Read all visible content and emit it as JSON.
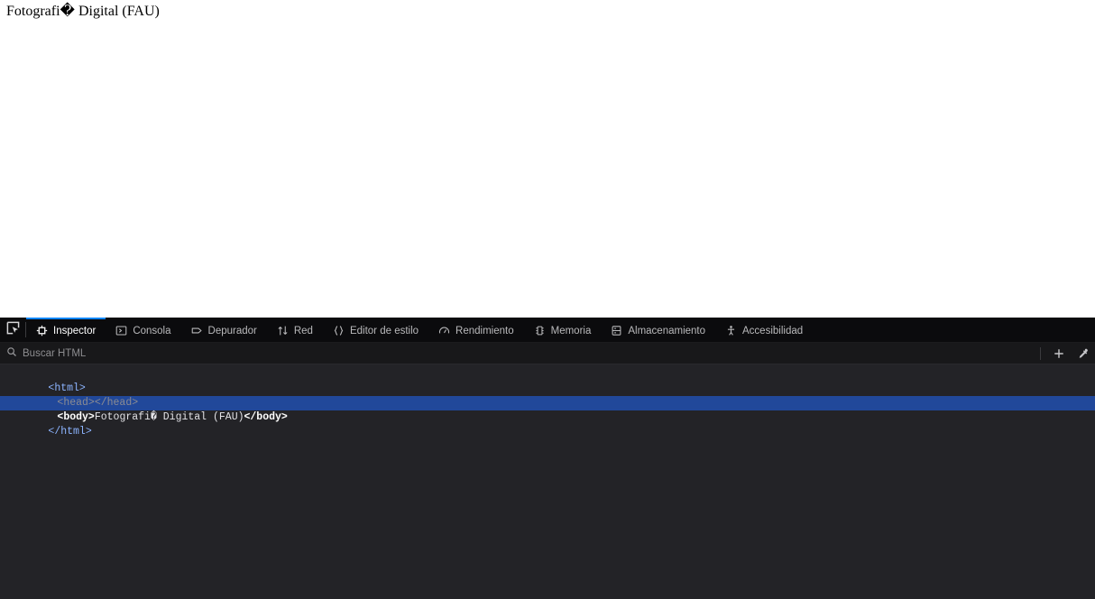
{
  "page": {
    "body_text": "Fotografi� Digital (FAU)"
  },
  "devtools": {
    "picker_icon": "element-picker-icon",
    "tabs": [
      {
        "id": "inspector",
        "label": "Inspector",
        "icon": "inspector-icon",
        "active": true
      },
      {
        "id": "console",
        "label": "Consola",
        "icon": "console-icon",
        "active": false
      },
      {
        "id": "debugger",
        "label": "Depurador",
        "icon": "debugger-icon",
        "active": false
      },
      {
        "id": "network",
        "label": "Red",
        "icon": "network-icon",
        "active": false
      },
      {
        "id": "style-editor",
        "label": "Editor de estilo",
        "icon": "braces-icon",
        "active": false
      },
      {
        "id": "performance",
        "label": "Rendimiento",
        "icon": "performance-icon",
        "active": false
      },
      {
        "id": "memory",
        "label": "Memoria",
        "icon": "memory-chip-icon",
        "active": false
      },
      {
        "id": "storage",
        "label": "Almacenamiento",
        "icon": "storage-icon",
        "active": false
      },
      {
        "id": "accessibility",
        "label": "Accesibilidad",
        "icon": "accessibility-icon",
        "active": false
      }
    ],
    "search": {
      "placeholder": "Buscar HTML",
      "value": "",
      "icon": "search-icon"
    },
    "actions": [
      {
        "id": "add-node",
        "icon": "plus-icon",
        "label": "+"
      },
      {
        "id": "color-picker",
        "icon": "eyedropper-icon",
        "label": ""
      }
    ],
    "markup": {
      "nodes": [
        {
          "id": "html-open",
          "depth": 0,
          "selected": false,
          "dim": false,
          "parts": [
            {
              "type": "tag",
              "text": "<html>"
            }
          ]
        },
        {
          "id": "head",
          "depth": 1,
          "selected": false,
          "dim": true,
          "parts": [
            {
              "type": "tag",
              "text": "<head></head>"
            }
          ]
        },
        {
          "id": "body",
          "depth": 1,
          "selected": true,
          "dim": false,
          "parts": [
            {
              "type": "tag",
              "text": "<body>"
            },
            {
              "type": "text",
              "text": "Fotografi� Digital (FAU)"
            },
            {
              "type": "tag",
              "text": "</body>"
            }
          ]
        },
        {
          "id": "html-close",
          "depth": 0,
          "selected": false,
          "dim": false,
          "parts": [
            {
              "type": "tag",
              "text": "</html>"
            }
          ]
        }
      ]
    }
  },
  "colors": {
    "accent": "#0a84ff",
    "selection": "#21489a",
    "toolbar_bg": "#0b0b0d",
    "searchbar_bg": "#18181a",
    "markup_bg": "#232327",
    "tag": "#8cb4ff"
  }
}
